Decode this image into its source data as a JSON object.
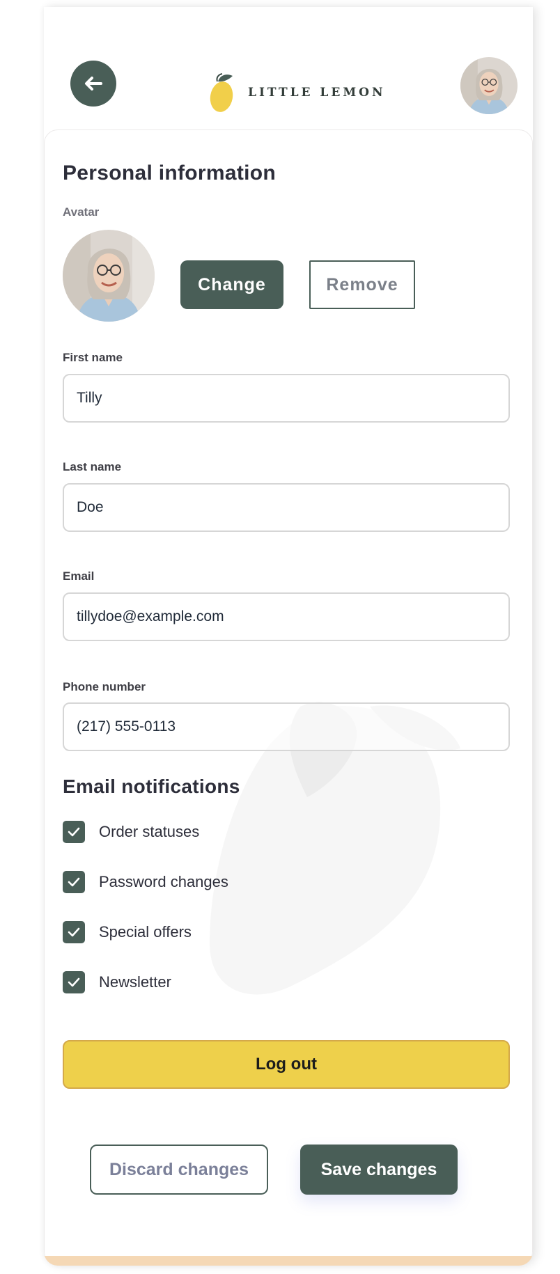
{
  "header": {
    "back_icon": "arrow-left-icon",
    "logo_icon": "lemon-icon",
    "brand_name": "LITTLE LEMON",
    "profile_avatar": "user-avatar"
  },
  "profile": {
    "section_title": "Personal information",
    "avatar_label": "Avatar",
    "change_label": "Change",
    "remove_label": "Remove",
    "first_name_label": "First name",
    "first_name_value": "Tilly",
    "last_name_label": "Last name",
    "last_name_value": "Doe",
    "email_label": "Email",
    "email_value": "tillydoe@example.com",
    "phone_label": "Phone number",
    "phone_value": "(217) 555-0113"
  },
  "notifications": {
    "title": "Email notifications",
    "items": [
      {
        "label": "Order statuses",
        "checked": true
      },
      {
        "label": "Password changes",
        "checked": true
      },
      {
        "label": "Special offers",
        "checked": true
      },
      {
        "label": "Newsletter",
        "checked": true
      }
    ]
  },
  "actions": {
    "logout_label": "Log out",
    "discard_label": "Discard changes",
    "save_label": "Save changes"
  },
  "colors": {
    "primary_green": "#495e57",
    "accent_yellow": "#eed04b"
  }
}
